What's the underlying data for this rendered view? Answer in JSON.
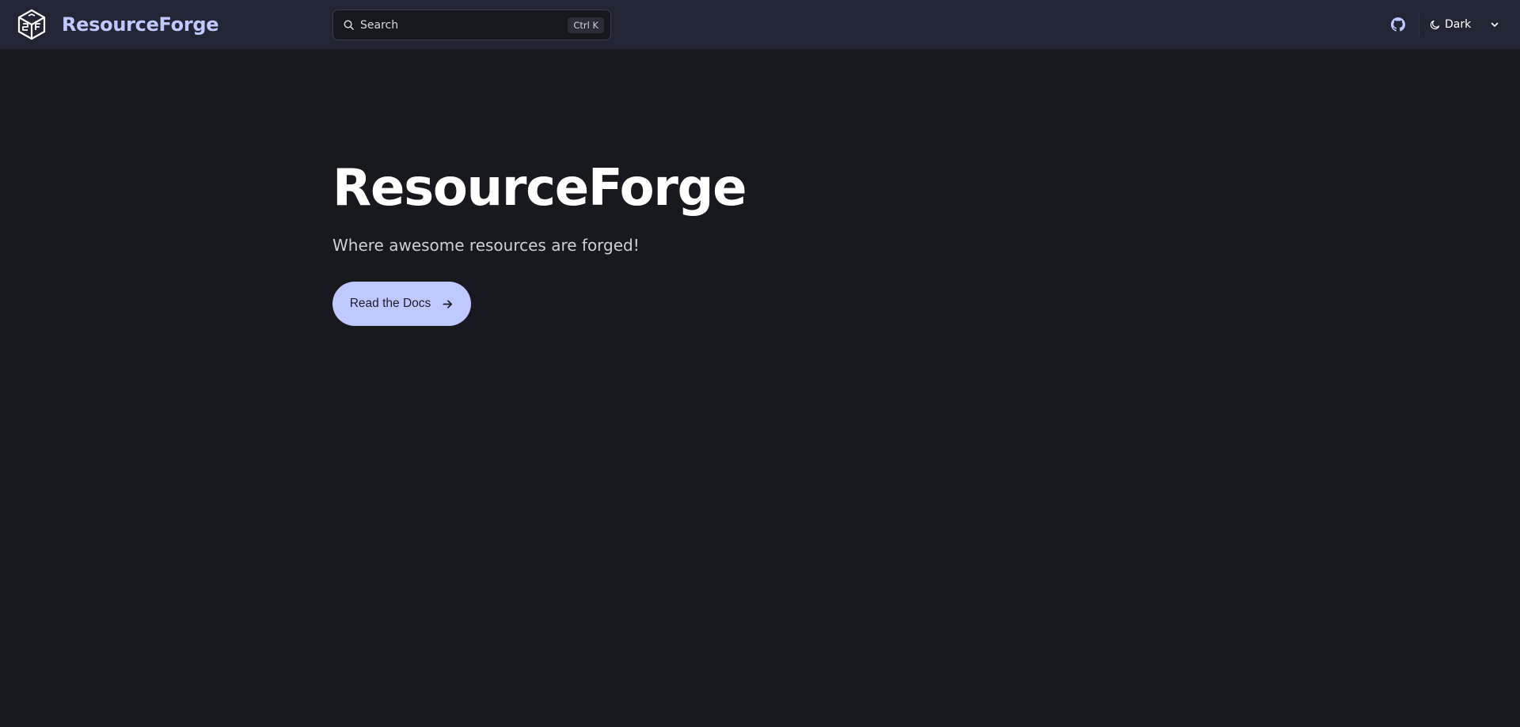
{
  "navbar": {
    "brand": {
      "name": "ResourceForge",
      "logo_icon": "cube-logo-icon"
    },
    "search": {
      "placeholder": "Search",
      "shortcut": "Ctrl K",
      "icon": "search-icon"
    },
    "github_icon": "github-icon",
    "theme": {
      "label": "Dark",
      "icon": "moon-icon",
      "chevron_icon": "chevron-down-icon"
    }
  },
  "hero": {
    "title": "ResourceForge",
    "tagline": "Where awesome resources are forged!",
    "cta": {
      "label": "Read the Docs",
      "icon": "arrow-right-icon"
    }
  },
  "colors": {
    "background": "#18191e",
    "navbar": "#222533",
    "accent": "#c0c9ff",
    "text": "#ffffff",
    "muted_text": "#cdd0da"
  }
}
